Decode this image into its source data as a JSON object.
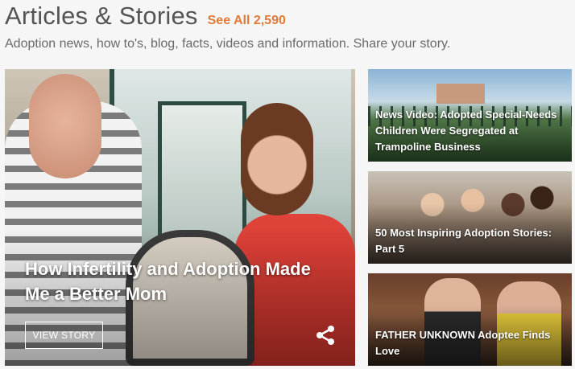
{
  "header": {
    "title": "Articles & Stories",
    "see_all_label": "See All 2,590",
    "subtitle": "Adoption news, how to's, blog, facts, videos and information. Share your story."
  },
  "featured": {
    "title": "How Infertility and Adoption Made Me a Better Mom",
    "button_label": "VIEW STORY",
    "share_icon": "share-icon"
  },
  "cards": [
    {
      "title": "News Video: Adopted Special-Needs Children Were Segregated at Trampoline Business"
    },
    {
      "title": "50 Most Inspiring Adoption Stories: Part 5"
    },
    {
      "title": "FATHER UNKNOWN Adoptee Finds Love"
    }
  ],
  "colors": {
    "accent": "#e07b3a",
    "title_text": "#555555",
    "subtitle_text": "#6a6a6a",
    "overlay_text": "#ffffff"
  }
}
